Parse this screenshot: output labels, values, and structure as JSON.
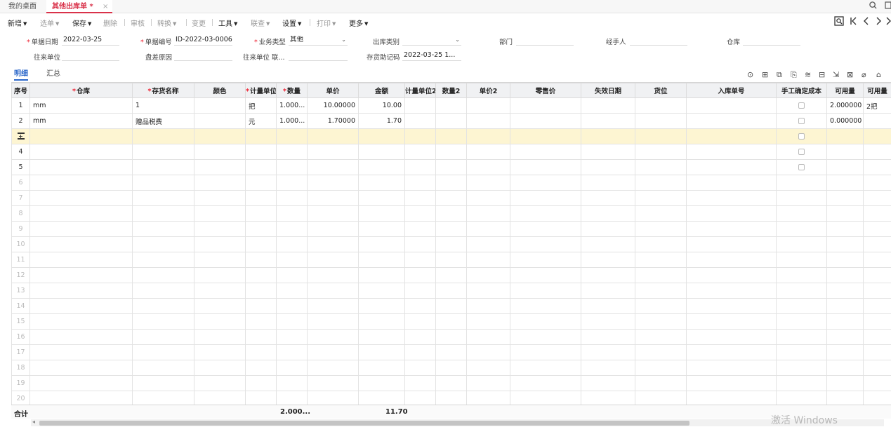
{
  "tabs": {
    "home": "我的桌面",
    "active": "其他出库单 *",
    "close": "×"
  },
  "toolbar": {
    "new": "新增",
    "select": "选单",
    "save": "保存",
    "delete": "删除",
    "audit": "审核",
    "convert": "转换",
    "change": "变更",
    "tools": "工具",
    "link": "联查",
    "settings": "设置",
    "print": "打印",
    "more": "更多"
  },
  "form": {
    "doc_date_label": "单据日期",
    "doc_date": "2022-03-25",
    "doc_no_label": "单据编号",
    "doc_no": "ID-2022-03-0006",
    "biz_type_label": "业务类型",
    "biz_type": "其他",
    "out_type_label": "出库类别",
    "out_type": "",
    "dept_label": "部门",
    "dept": "",
    "handler_label": "经手人",
    "handler": "",
    "warehouse_label": "仓库",
    "warehouse": "",
    "partner_label": "往来单位",
    "partner": "",
    "diff_reason_label": "盘差原因",
    "diff_reason": "",
    "partner_contact_label": "往来单位 联...",
    "partner_contact": "",
    "stock_memo_label": "存货助记码",
    "stock_memo": "2022-03-25 1..."
  },
  "subtabs": {
    "detail": "明细",
    "summary": "汇总"
  },
  "grid": {
    "headers": {
      "seq": "序号",
      "warehouse": "仓库",
      "item_name": "存货名称",
      "color": "颜色",
      "unit": "计量单位",
      "qty": "数量",
      "price": "单价",
      "amount": "金额",
      "unit2": "计量单位2",
      "qty2": "数量2",
      "price2": "单价2",
      "retail": "零售价",
      "expiry": "失效日期",
      "location": "货位",
      "in_no": "入库单号",
      "manual_cost": "手工确定成本",
      "avail_qty": "可用量",
      "avail_qty2": "可用量"
    },
    "rows": [
      {
        "seq": "1",
        "warehouse": "mm",
        "item_name": "1",
        "unit": "把",
        "qty": "1.000...",
        "price": "10.00000",
        "amount": "10.00",
        "avail": "2.000000",
        "avail2": "2把"
      },
      {
        "seq": "2",
        "warehouse": "mm",
        "item_name": "赠品税费",
        "unit": "元",
        "qty": "1.000...",
        "price": "1.70000",
        "amount": "1.70",
        "avail": "0.000000",
        "avail2": ""
      },
      {
        "seq": "3"
      },
      {
        "seq": "4"
      },
      {
        "seq": "5"
      },
      {
        "seq": "6"
      },
      {
        "seq": "7"
      },
      {
        "seq": "8"
      },
      {
        "seq": "9"
      },
      {
        "seq": "10"
      },
      {
        "seq": "11"
      },
      {
        "seq": "12"
      },
      {
        "seq": "13"
      },
      {
        "seq": "14"
      },
      {
        "seq": "15"
      },
      {
        "seq": "16"
      },
      {
        "seq": "17"
      },
      {
        "seq": "18"
      },
      {
        "seq": "19"
      },
      {
        "seq": "20"
      }
    ]
  },
  "footer": {
    "label": "合计",
    "qty_total": "2.000...",
    "amount_total": "11.70"
  },
  "watermark": "激活 Windows"
}
